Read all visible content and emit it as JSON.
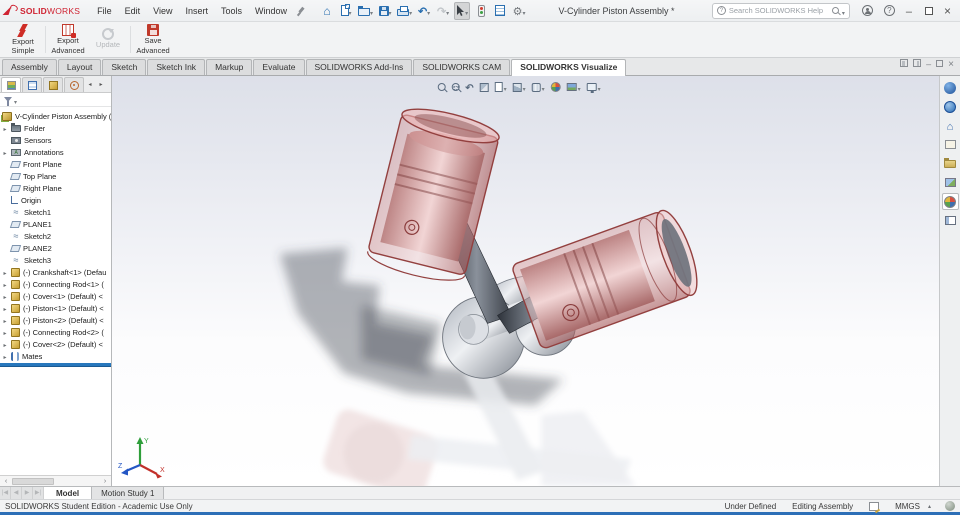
{
  "window": {
    "title": "V-Cylinder Piston Assembly *",
    "brand_bold": "SOLID",
    "brand_light": "WORKS"
  },
  "menubar": {
    "items": [
      "File",
      "Edit",
      "View",
      "Insert",
      "Tools",
      "Window"
    ]
  },
  "titlebar_icons": [
    "home",
    "new-document",
    "open-document",
    "save",
    "print",
    "undo",
    "redo",
    "select-cursor",
    "rebuild-traffic-light",
    "file-properties",
    "options-gear"
  ],
  "search": {
    "placeholder": "Search SOLIDWORKS Help"
  },
  "ribbon": {
    "buttons": [
      {
        "l1": "Export",
        "l2": "Simple",
        "disabled": false
      },
      {
        "l1": "Export",
        "l2": "Advanced",
        "disabled": false
      },
      {
        "l1": "Update",
        "l2": "",
        "disabled": true
      },
      {
        "l1": "Save",
        "l2": "Advanced",
        "disabled": false
      }
    ]
  },
  "commandbar": {
    "tabs": [
      "Assembly",
      "Layout",
      "Sketch",
      "Sketch Ink",
      "Markup",
      "Evaluate",
      "SOLIDWORKS Add-Ins",
      "SOLIDWORKS CAM",
      "SOLIDWORKS Visualize"
    ],
    "active_tab": "SOLIDWORKS Visualize"
  },
  "panel_tabs": [
    "featuremanager-design-tree",
    "propertymanager",
    "configurationmanager",
    "dimxpertmanager"
  ],
  "feature_tree": {
    "root": "V-Cylinder Piston Assembly (",
    "items": [
      {
        "label": "Folder",
        "icon": "folder",
        "expandable": true
      },
      {
        "label": "Sensors",
        "icon": "sensors",
        "expandable": false
      },
      {
        "label": "Annotations",
        "icon": "annotations",
        "expandable": true
      },
      {
        "label": "Front Plane",
        "icon": "plane",
        "expandable": false
      },
      {
        "label": "Top Plane",
        "icon": "plane",
        "expandable": false
      },
      {
        "label": "Right Plane",
        "icon": "plane",
        "expandable": false
      },
      {
        "label": "Origin",
        "icon": "origin",
        "expandable": false
      },
      {
        "label": "Sketch1",
        "icon": "sketch",
        "expandable": false
      },
      {
        "label": "PLANE1",
        "icon": "plane",
        "expandable": false
      },
      {
        "label": "Sketch2",
        "icon": "sketch",
        "expandable": false
      },
      {
        "label": "PLANE2",
        "icon": "plane",
        "expandable": false
      },
      {
        "label": "Sketch3",
        "icon": "sketch",
        "expandable": false
      },
      {
        "label": "(-) Crankshaft<1> (Defau",
        "icon": "part",
        "expandable": true
      },
      {
        "label": "(-) Connecting Rod<1> (",
        "icon": "part",
        "expandable": true
      },
      {
        "label": "(-) Cover<1> (Default) <",
        "icon": "part",
        "expandable": true
      },
      {
        "label": "(-) Piston<1> (Default) <",
        "icon": "part",
        "expandable": true
      },
      {
        "label": "(-) Piston<2> (Default) <",
        "icon": "part",
        "expandable": true
      },
      {
        "label": "(-) Connecting Rod<2> (",
        "icon": "part",
        "expandable": true
      },
      {
        "label": "(-) Cover<2> (Default) <",
        "icon": "part",
        "expandable": true
      },
      {
        "label": "Mates",
        "icon": "mates",
        "expandable": true
      }
    ]
  },
  "hud_icons": [
    "zoom-to-fit",
    "zoom-to-area",
    "previous-view",
    "section-view",
    "annotation-views",
    "view-orientation",
    "display-style",
    "edit-appearance",
    "apply-scene",
    "view-settings"
  ],
  "taskpane_icons": [
    "3dexperience",
    "solidworks-forum",
    "solidworks-resources",
    "view-palette",
    "file-explorer",
    "appearances",
    "appearances-scenes-decals",
    "custom-properties"
  ],
  "triad": {
    "x": "X",
    "y": "Y",
    "z": "Z"
  },
  "doc_tabs": [
    "Model",
    "Motion Study 1"
  ],
  "statusbar": {
    "left": "SOLIDWORKS Student Edition - Academic Use Only",
    "under_defined": "Under Defined",
    "editing": "Editing Assembly",
    "units": "MMGS"
  },
  "colors": {
    "brand_red": "#cf2332",
    "toolbar_blue": "#2a6fb0",
    "rollback_blue": "#2878bd",
    "piston_transparent_red": "#c87e7e",
    "rod_gray": "#3a3f47",
    "viewport_top": "#dde0e9"
  }
}
